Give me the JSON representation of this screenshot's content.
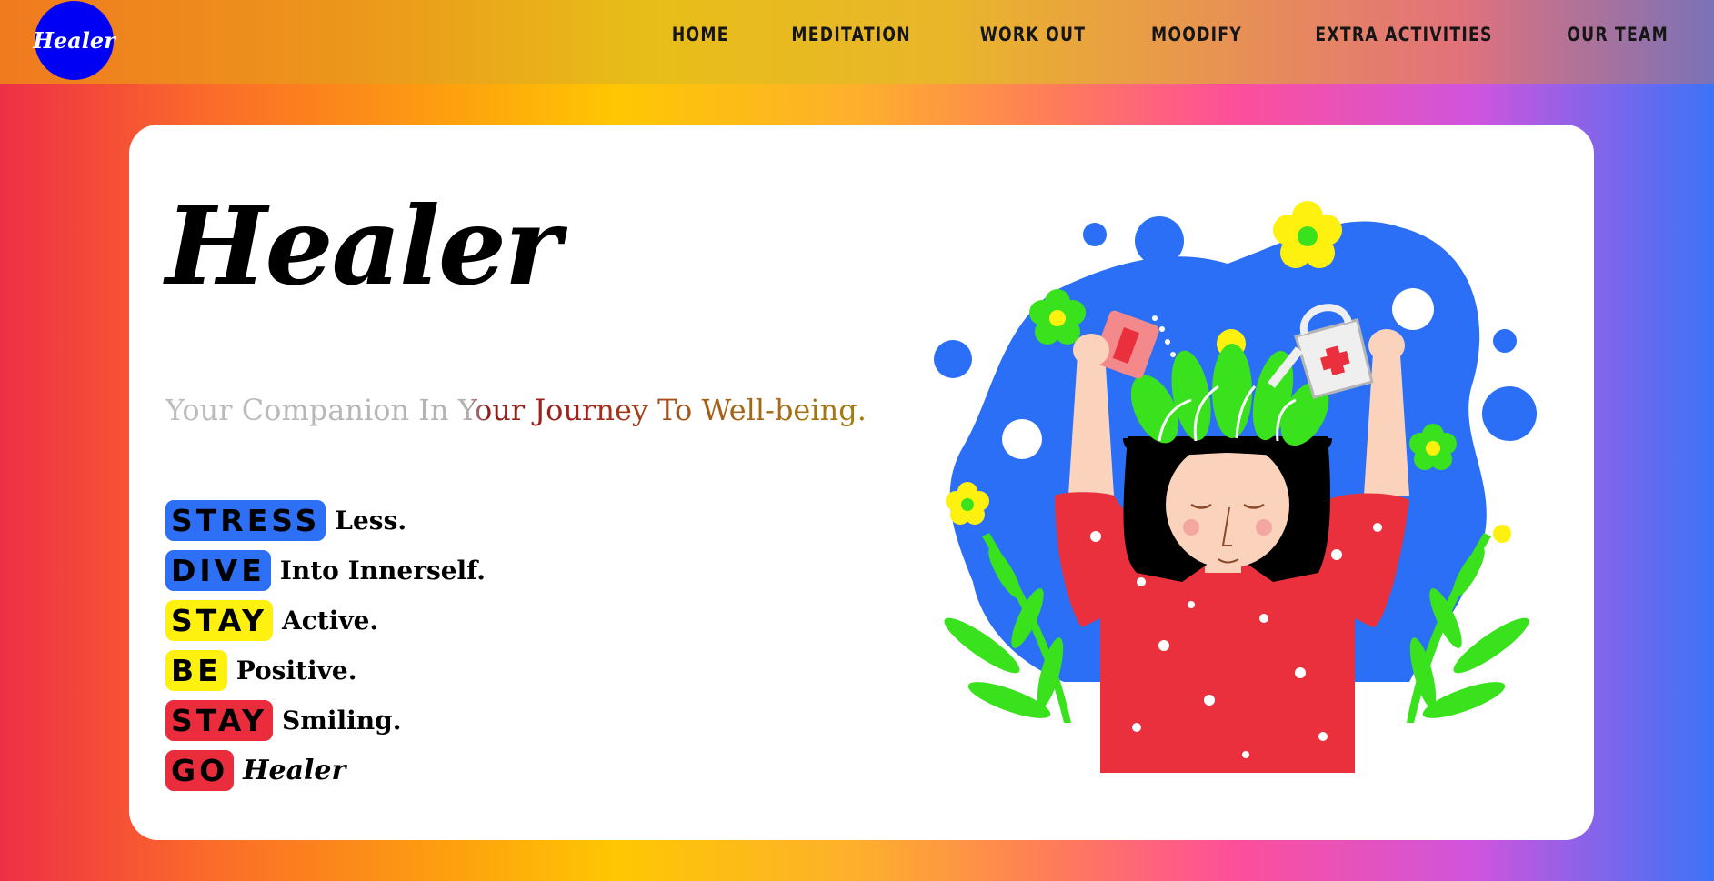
{
  "navbar": {
    "logo_text": "Healer",
    "links": [
      "HOME",
      "MEDITATION",
      "WORK OUT",
      "MOODIFY",
      "EXTRA ACTIVITIES",
      "OUR TEAM"
    ]
  },
  "hero": {
    "title": "Healer",
    "tagline": "Your Companion In Your Journey To Well-being.",
    "mottos": [
      {
        "badge": "STRESS",
        "text": "Less.",
        "color": "#2d6ff5"
      },
      {
        "badge": "DIVE",
        "text": "Into Innerself.",
        "color": "#2d6ff5"
      },
      {
        "badge": "STAY",
        "text": "Active.",
        "color": "#fff10f"
      },
      {
        "badge": "BE",
        "text": "Positive.",
        "color": "#fff10f"
      },
      {
        "badge": "STAY",
        "text": "Smiling.",
        "color": "#eb2c3c"
      },
      {
        "badge": "GO",
        "text": "Healer",
        "color": "#eb2c3c"
      }
    ],
    "illustration_icon": "mental-wellbeing-illustration"
  },
  "colors": {
    "logo": "#0000f5",
    "blob": "#2b6ff6",
    "leaf": "#39e21c",
    "shirt": "#e9303c"
  }
}
